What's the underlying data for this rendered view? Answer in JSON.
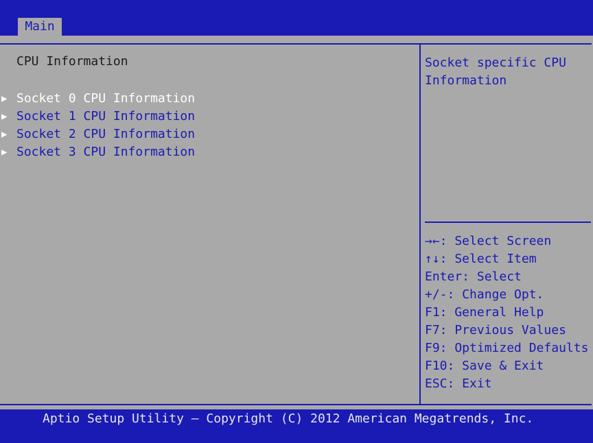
{
  "header": {
    "tabs": [
      {
        "label": "Main"
      }
    ]
  },
  "main": {
    "section_title": "CPU Information",
    "items": [
      {
        "label": "Socket 0 CPU Information"
      },
      {
        "label": "Socket 1 CPU Information"
      },
      {
        "label": "Socket 2 CPU Information"
      },
      {
        "label": "Socket 3 CPU Information"
      }
    ],
    "selected_index": 0
  },
  "help": {
    "text": "Socket specific CPU\nInformation",
    "keys": [
      "→←: Select Screen",
      "↑↓: Select Item",
      "Enter: Select",
      "+/-: Change Opt.",
      "F1: General Help",
      "F7: Previous Values",
      "F9: Optimized Defaults",
      "F10: Save & Exit",
      "ESC: Exit"
    ]
  },
  "footer": {
    "text": "Aptio Setup Utility – Copyright (C) 2012 American Megatrends, Inc."
  },
  "colors": {
    "bios_blue": "#1a1ab4",
    "panel_gray": "#a9a9a9",
    "selected_text": "#ffffff"
  },
  "icons": {
    "submenu_arrow": "triangle-right-icon"
  }
}
